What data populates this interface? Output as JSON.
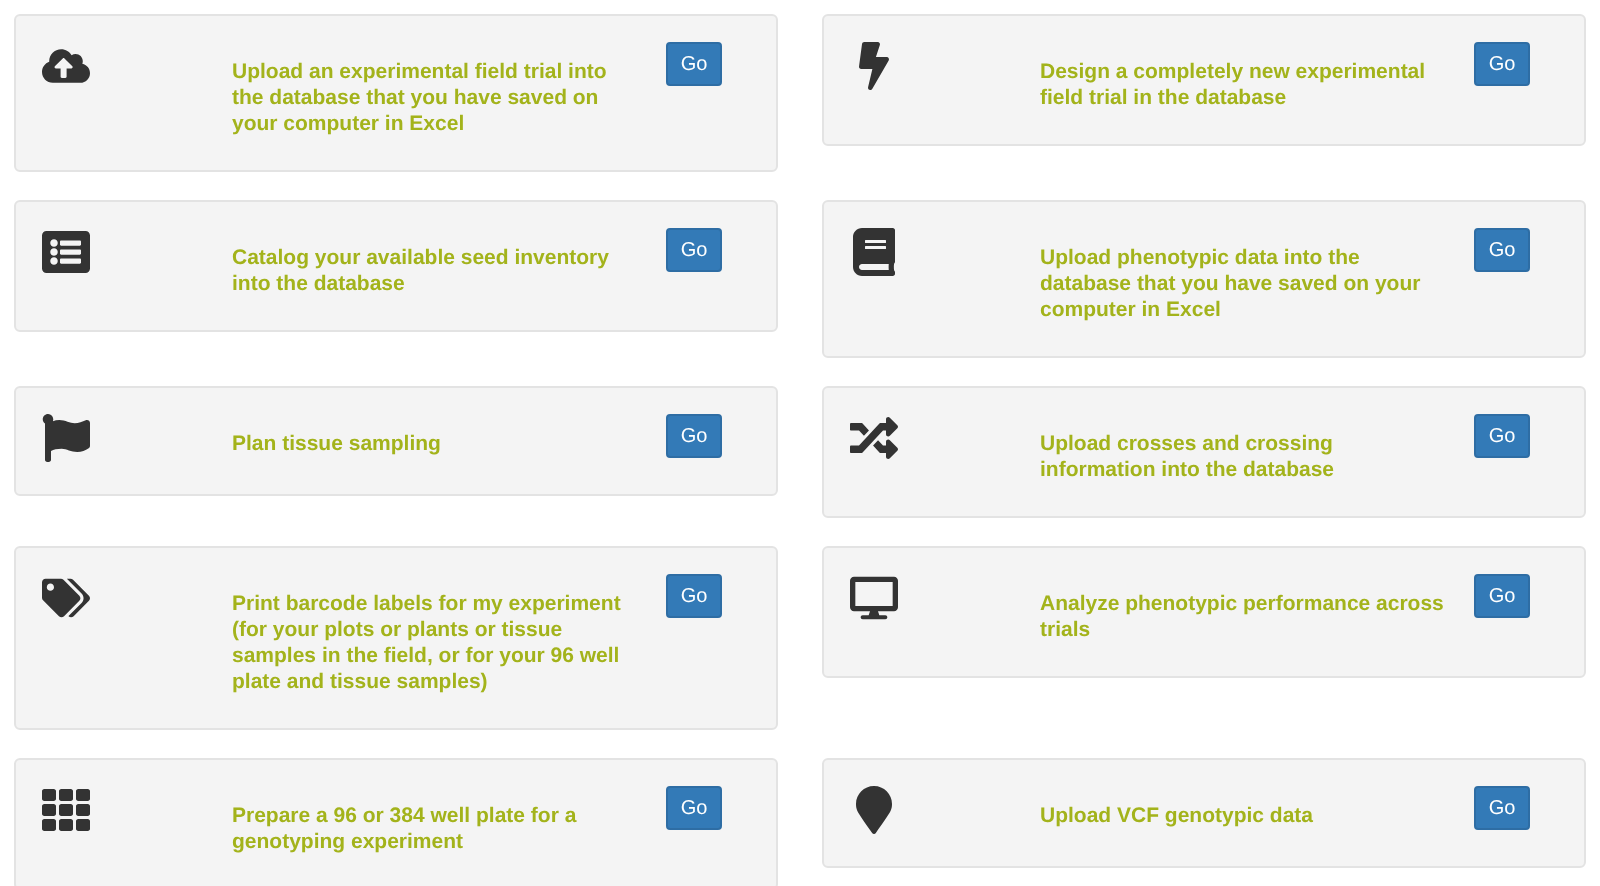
{
  "cards": [
    {
      "text": "Upload an experimental field trial into the database that you have saved on your computer in Excel",
      "button": "Go"
    },
    {
      "text": "Design a completely new experimental field trial in the database",
      "button": "Go"
    },
    {
      "text": "Catalog your available seed inventory into the database",
      "button": "Go"
    },
    {
      "text": "Upload phenotypic data into the database that you have saved on your computer in Excel",
      "button": "Go"
    },
    {
      "text": "Plan tissue sampling",
      "button": "Go"
    },
    {
      "text": "Upload crosses and crossing information into the database",
      "button": "Go"
    },
    {
      "text": "Print barcode labels for my experiment (for your plots or plants or tissue samples in the field, or for your 96 well plate and tissue samples)",
      "button": "Go"
    },
    {
      "text": "Analyze phenotypic performance across trials",
      "button": "Go"
    },
    {
      "text": "Prepare a 96 or 384 well plate for a genotyping experiment",
      "button": "Go"
    },
    {
      "text": "Upload VCF genotypic data",
      "button": "Go"
    }
  ]
}
